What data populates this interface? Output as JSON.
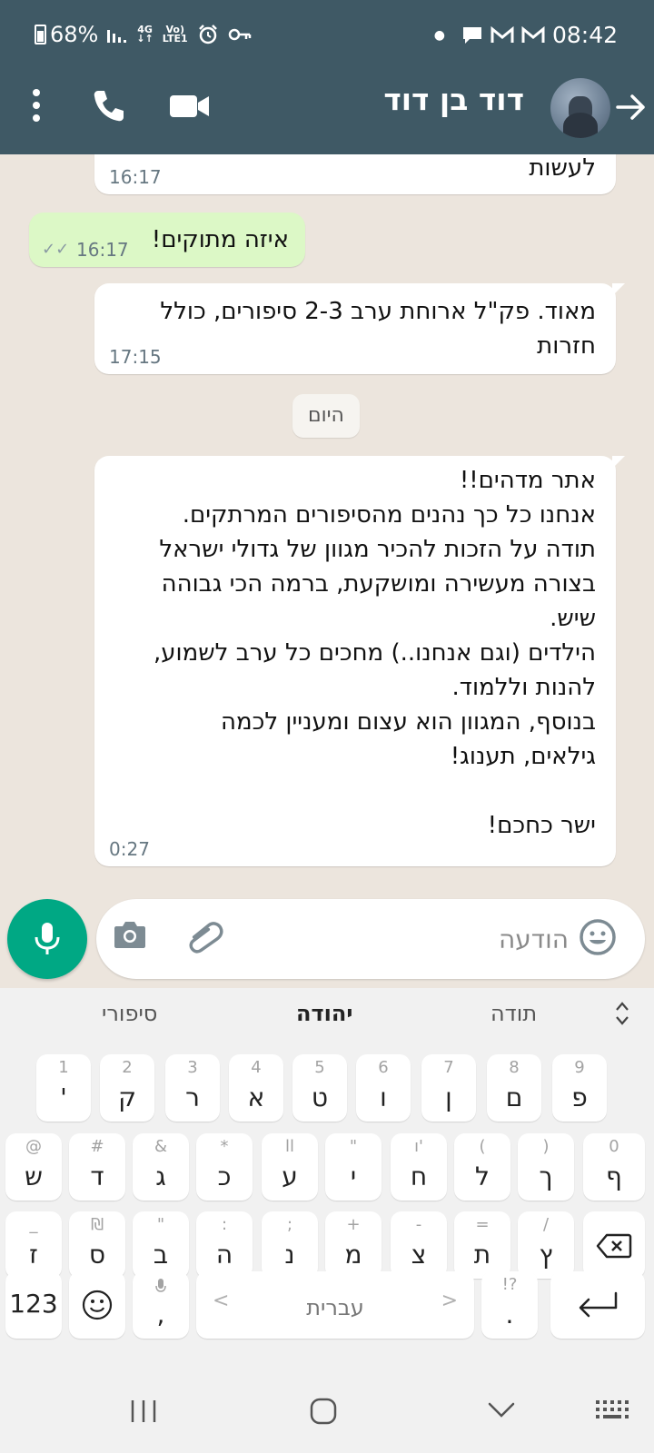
{
  "status_bar": {
    "battery": "68%",
    "network": "4G",
    "volte_top": "Vo)",
    "volte_bottom": "LTE1",
    "time": "08:42"
  },
  "header": {
    "contact_name": "דוד בן דוד",
    "icons": [
      "back-arrow-icon",
      "video-call-icon",
      "phone-icon",
      "more-options-icon"
    ]
  },
  "messages": [
    {
      "direction": "in",
      "text": "לעשות",
      "time": "16:17"
    },
    {
      "direction": "out",
      "text": "איזה מתוקים!",
      "time": "16:17",
      "status": "read"
    },
    {
      "direction": "in",
      "text": "מאוד. פק\"ל ארוחת ערב 2-3 סיפורים, כולל\nחזרות",
      "time": "17:15"
    },
    {
      "direction": "in",
      "text": "אתר מדהים!!\nאנחנו כל כך נהנים מהסיפורים המרתקים.\nתודה על הזכות להכיר מגוון של גדולי ישראל\nבצורה מעשירה ומושקעת, ברמה הכי גבוהה\nשיש.\nהילדים (וגם אנחנו..) מחכים כל ערב לשמוע,\nלהנות וללמוד.\nבנוסף, המגוון הוא עצום ומעניין לכמה\nגילאים, תענוג!\n\nישר כחכם!",
      "time": "0:27"
    }
  ],
  "date_separator": "היום",
  "composer": {
    "placeholder": "הודעה",
    "icons": [
      "emoji-icon",
      "attach-icon",
      "camera-icon",
      "mic-icon"
    ]
  },
  "keyboard": {
    "suggestions": [
      "תודה",
      "יהודה",
      "סיפורי"
    ],
    "row1": [
      {
        "key": "פ",
        "hint": "9"
      },
      {
        "key": "ם",
        "hint": "8"
      },
      {
        "key": "ן",
        "hint": "7"
      },
      {
        "key": "ו",
        "hint": "6"
      },
      {
        "key": "ט",
        "hint": "5"
      },
      {
        "key": "א",
        "hint": "4"
      },
      {
        "key": "ר",
        "hint": "3"
      },
      {
        "key": "ק",
        "hint": "2"
      },
      {
        "key": "'",
        "hint": "1"
      }
    ],
    "row2": [
      {
        "key": "ף",
        "hint": "0"
      },
      {
        "key": "ך",
        "hint": ")"
      },
      {
        "key": "ל",
        "hint": "("
      },
      {
        "key": "ח",
        "hint": "ו'"
      },
      {
        "key": "י",
        "hint": "\""
      },
      {
        "key": "ע",
        "hint": "ll"
      },
      {
        "key": "כ",
        "hint": "*"
      },
      {
        "key": "ג",
        "hint": "&"
      },
      {
        "key": "ד",
        "hint": "#"
      },
      {
        "key": "ש",
        "hint": "@"
      }
    ],
    "row3": [
      {
        "key": "ץ",
        "hint": "/"
      },
      {
        "key": "ת",
        "hint": "="
      },
      {
        "key": "צ",
        "hint": "-"
      },
      {
        "key": "מ",
        "hint": "+"
      },
      {
        "key": "נ",
        "hint": ";"
      },
      {
        "key": "ה",
        "hint": ":"
      },
      {
        "key": "ב",
        "hint": "\""
      },
      {
        "key": "ס",
        "hint": "₪"
      },
      {
        "key": "ז",
        "hint": "_"
      }
    ],
    "numbers_key": "123",
    "comma_key": ",",
    "space_label": "עברית",
    "period_key": ".",
    "period_hint": "!?",
    "accent_color": "#00a884"
  },
  "colors": {
    "header": "#3f5965",
    "outgoing_bubble": "#dcf8c6",
    "incoming_bubble": "#ffffff",
    "chat_background": "#ece5dd"
  }
}
